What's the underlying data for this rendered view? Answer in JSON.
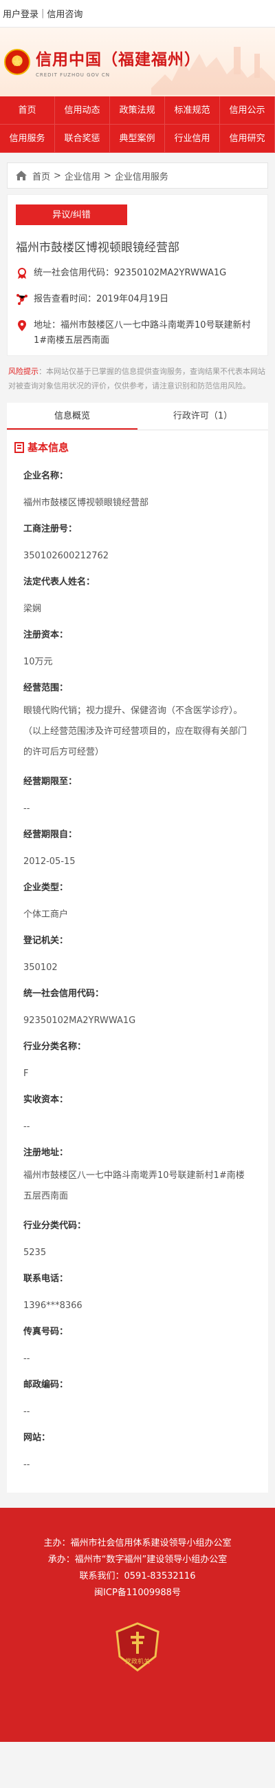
{
  "topbar": {
    "login": "用户登录",
    "search": "信用咨询"
  },
  "brand": {
    "title": "信用中国（福建福州）",
    "subtitle": "CREDIT FUZHOU GOV CN"
  },
  "nav": [
    "首页",
    "信用动态",
    "政策法规",
    "标准规范",
    "信用公示",
    "信用服务",
    "联合奖惩",
    "典型案例",
    "行业信用",
    "信用研究"
  ],
  "breadcrumb": {
    "home": "首页",
    "level1": "企业信用",
    "level2": "企业信用服务"
  },
  "company": {
    "objection_button": "异议/纠错",
    "name": "福州市鼓楼区博视顿眼镜经营部",
    "credit_code": "统一社会信用代码：92350102MA2YRWWA1G",
    "report_time": "报告查看时间：2019年04月19日",
    "address": "地址：福州市鼓楼区八一七中路斗南墘弄10号联建新村1#南楼五层西南面"
  },
  "risk": {
    "label": "风险提示",
    "text": "：本网站仅基于已掌握的信息提供查询服务，查询结果不代表本网站对被查询对象信用状况的评价，仅供参考，请注意识别和防范信用风险。"
  },
  "tabs": [
    "信息概览",
    "行政许可（1）"
  ],
  "section_title": "基本信息",
  "fields": {
    "name_label": "企业名称：",
    "name_value": "福州市鼓楼区博视顿眼镜经营部",
    "reg_label": "工商注册号：",
    "reg_value": "350102600212762",
    "legal_label": "法定代表人姓名：",
    "legal_value": "梁娴",
    "capital_label": "注册资本：",
    "capital_value": "10万元",
    "scope_label": "经营范围：",
    "scope_value": "眼镜代购代销；视力提升、保健咨询（不含医学诊疗）。（以上经营范围涉及许可经营项目的，应在取得有关部门的许可后方可经营）",
    "term_label": "经营期限至：",
    "term_value": "--",
    "start_label": "经营期限自：",
    "start_value": "2012-05-15",
    "type_label": "企业类型：",
    "type_value": "个体工商户",
    "authority_label": "登记机关：",
    "authority_value": "350102",
    "code_label": "统一社会信用代码：",
    "code_value": "92350102MA2YRWWA1G",
    "industry_label": "行业分类名称：",
    "industry_value": "F",
    "paid_label": "实收资本：",
    "paid_value": "--",
    "addr_label": "注册地址：",
    "addr_value": "福州市鼓楼区八一七中路斗南墘弄10号联建新村1#南楼五层西南面",
    "industry_code_label": "行业分类代码：",
    "industry_code_value": "5235",
    "phone_label": "联系电话：",
    "phone_value": "1396***8366",
    "fax_label": "传真号码：",
    "fax_value": "--",
    "zip_label": "邮政编码：",
    "zip_value": "--",
    "site_label": "网站：",
    "site_value": "--"
  },
  "footer": {
    "host": "主办：福州市社会信用体系建设领导小组办公室",
    "organizer": "承办：福州市“数字福州”建设领导小组办公室",
    "contact": "联系我们：0591-83532116",
    "icp": "闽ICP备11009988号",
    "badge_text": "党政机关"
  },
  "colors": {
    "primary": "#e02020",
    "footer": "#d32323"
  }
}
